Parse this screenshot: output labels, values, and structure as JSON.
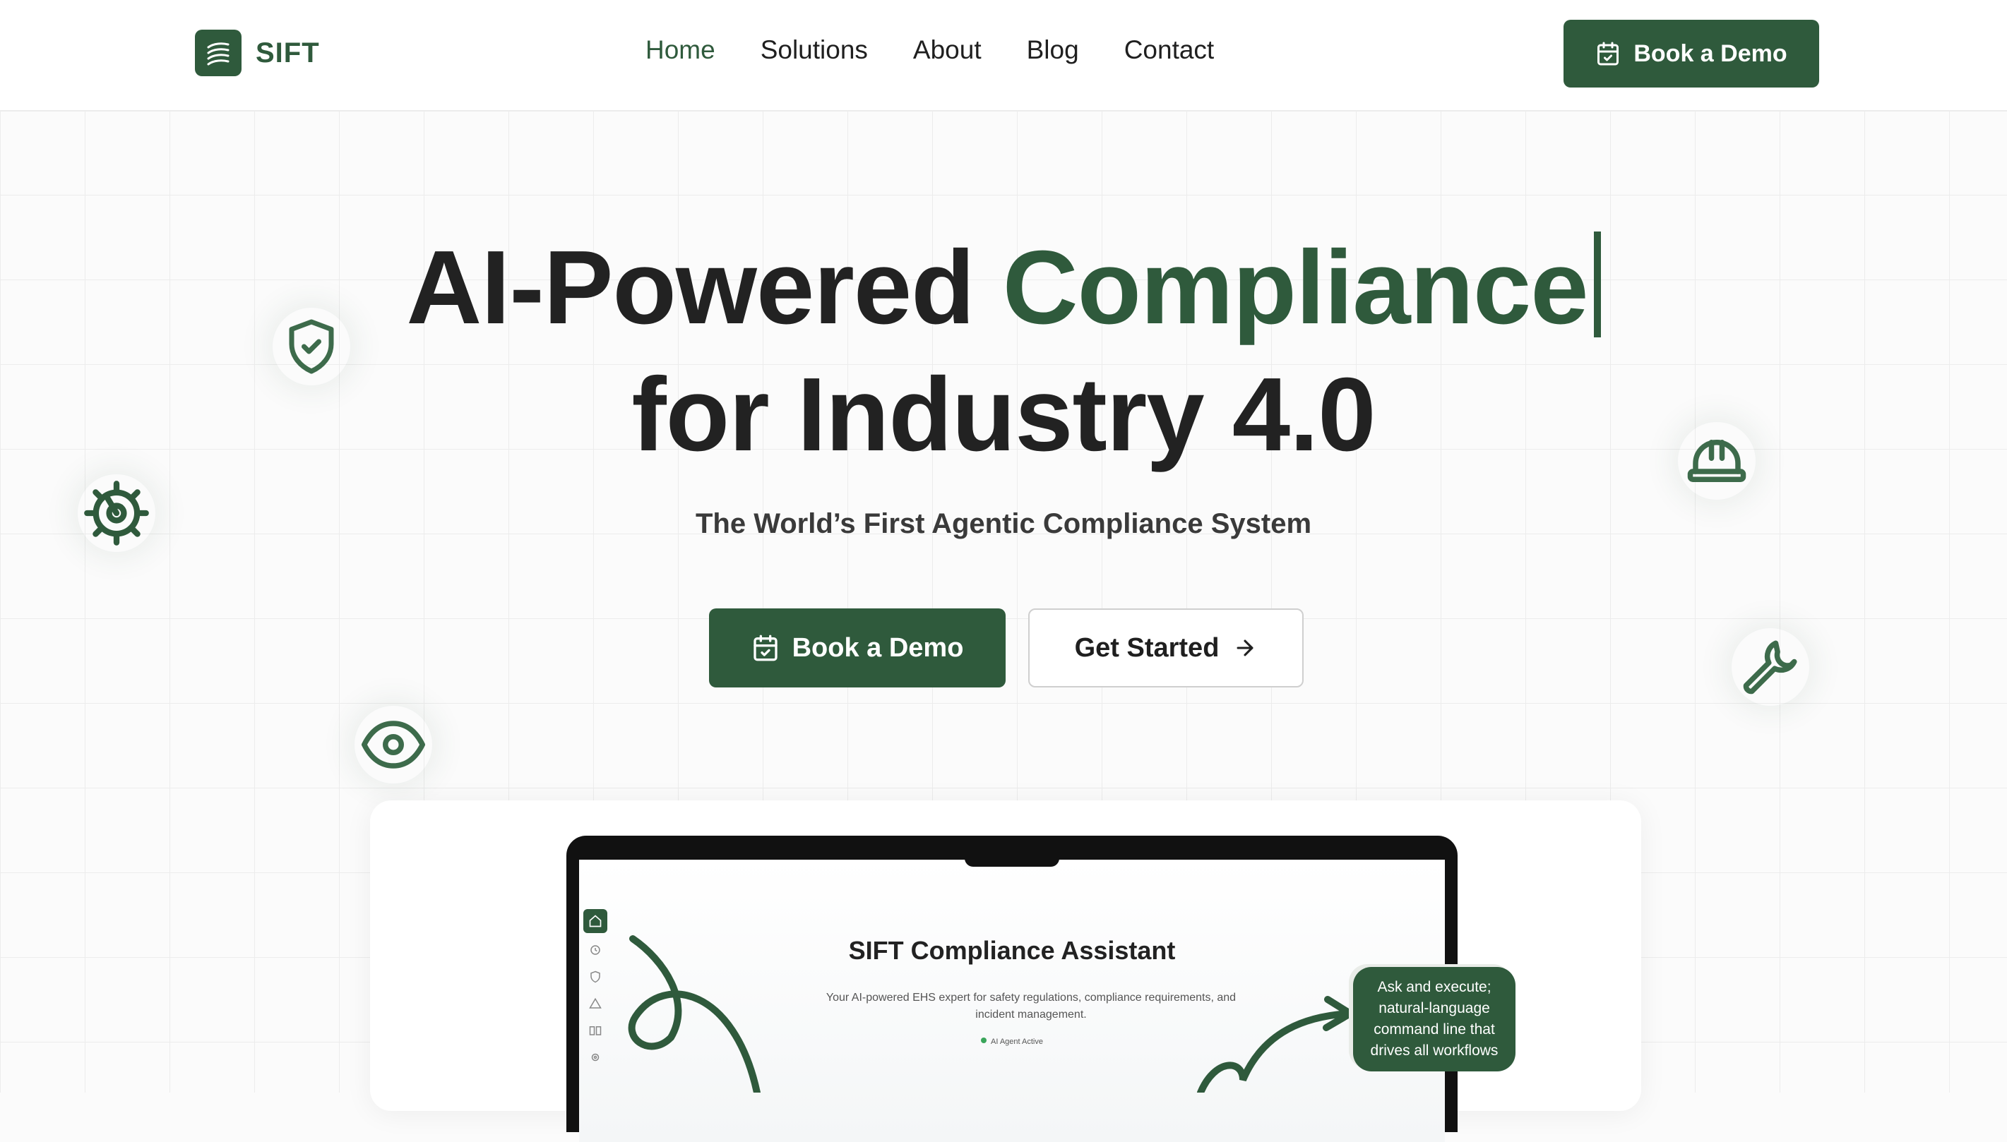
{
  "nav": {
    "logo_text": "SIFT",
    "links": [
      "Home",
      "Solutions",
      "About",
      "Blog",
      "Contact"
    ],
    "active_link": "Home",
    "cta_label": "Book a Demo"
  },
  "hero": {
    "title_part1": "AI-Powered ",
    "title_accent": "Compliance",
    "title_line2": "for Industry 4.0",
    "subtitle": "The World’s First Agentic Compliance System",
    "primary_cta": "Book a Demo",
    "secondary_cta": "Get Started"
  },
  "preview": {
    "app_title": "SIFT Compliance Assistant",
    "app_description": "Your AI-powered EHS expert for safety regulations, compliance requirements, and incident management.",
    "status": "AI Agent Active",
    "callout": "Ask and execute; natural-language command line that drives all workflows"
  },
  "colors": {
    "brand_green": "#2f5a3c",
    "text_dark": "#1f1f1f",
    "background": "#fbfbfb"
  },
  "icons": [
    "shield-check-icon",
    "gear-icon",
    "eye-icon",
    "hard-hat-icon",
    "wrench-icon",
    "calendar-check-icon",
    "arrow-right-icon"
  ]
}
